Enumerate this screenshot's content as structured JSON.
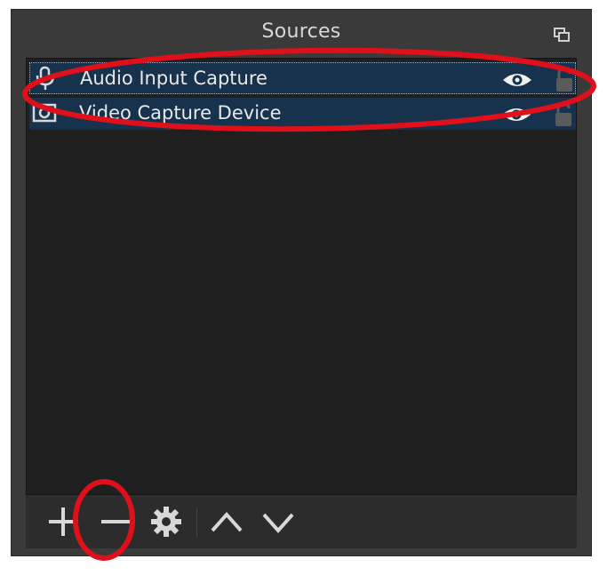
{
  "panel": {
    "title": "Sources"
  },
  "sources": [
    {
      "label": "Audio Input Capture",
      "type_icon": "microphone-icon",
      "visible": true,
      "locked": false
    },
    {
      "label": "Video Capture Device",
      "type_icon": "camera-icon",
      "visible": true,
      "locked": false
    }
  ],
  "toolbar": {
    "buttons": [
      "plus-icon",
      "minus-icon",
      "gear-icon",
      "chevron-up-icon",
      "chevron-down-icon"
    ]
  },
  "colors": {
    "panel_bg": "#3a3a3a",
    "list_bg": "#1f1f1f",
    "selected_row": "#17324c",
    "annotation": "#e0101a"
  }
}
